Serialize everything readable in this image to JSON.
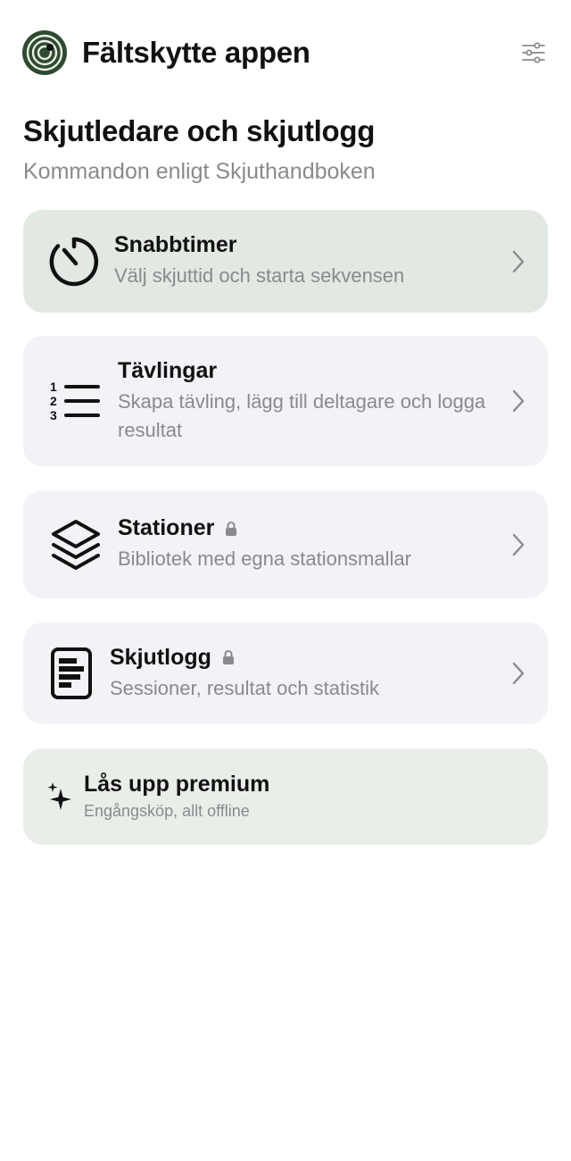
{
  "header": {
    "app_title": "Fältskytte appen"
  },
  "section": {
    "title": "Skjutledare och skjutlogg",
    "subtitle": "Kommandon enligt Skjuthandboken"
  },
  "menu": [
    {
      "title": "Snabbtimer",
      "subtitle": "Välj skjuttid och starta sekvensen",
      "icon": "timer-icon",
      "locked": false
    },
    {
      "title": "Tävlingar",
      "subtitle": "Skapa tävling, lägg till deltagare och logga resultat",
      "icon": "numbered-list-icon",
      "locked": false
    },
    {
      "title": "Stationer",
      "subtitle": "Bibliotek med egna stationsmallar",
      "icon": "layers-icon",
      "locked": true
    },
    {
      "title": "Skjutlogg",
      "subtitle": "Sessioner, resultat och statistik",
      "icon": "document-icon",
      "locked": true
    }
  ],
  "premium": {
    "title": "Lås upp premium",
    "subtitle": "Engångsköp, allt offline",
    "icon": "sparkles-icon"
  },
  "colors": {
    "accent_green": "#2e4a2e",
    "card_green": "#e2e8e2",
    "card_grey": "#f2f2f7",
    "secondary_text": "#8a8a8e"
  }
}
